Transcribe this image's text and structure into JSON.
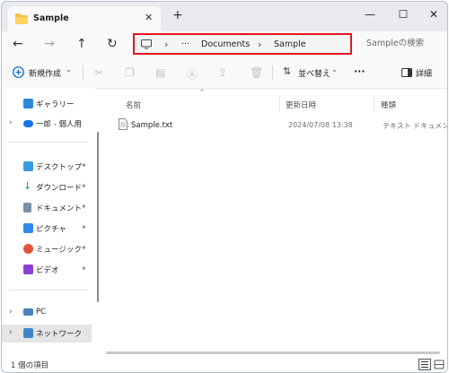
{
  "tab": {
    "title": "Sample",
    "close_label": "✕"
  },
  "titlebar": {
    "new_tab": "+",
    "minimize": "—",
    "maximize": "☐",
    "close": "✕"
  },
  "nav": {
    "back": "←",
    "forward": "→",
    "up": "↑",
    "refresh": "↻",
    "breadcrumb": {
      "chevron": "›",
      "more": "···",
      "items": [
        "Documents",
        "Sample"
      ]
    },
    "search_placeholder": "Sampleの検索"
  },
  "toolbar": {
    "new_label": "新規作成",
    "sort_label": "並べ替え",
    "more_label": "···",
    "details_label": "詳細",
    "caret": "⌄"
  },
  "sidebar": {
    "items": [
      {
        "label": "ギャラリー"
      },
      {
        "label": "一郎 - 個人用"
      },
      {
        "label": "デスクトップ"
      },
      {
        "label": "ダウンロード"
      },
      {
        "label": "ドキュメント"
      },
      {
        "label": "ピクチャ"
      },
      {
        "label": "ミュージック"
      },
      {
        "label": "ビデオ"
      },
      {
        "label": "PC"
      },
      {
        "label": "ネットワーク"
      }
    ],
    "pin_glyph": "📌",
    "expand_glyph": "›"
  },
  "columns": {
    "name": "名前",
    "date": "更新日時",
    "type": "種類"
  },
  "files": [
    {
      "name": "Sample.txt",
      "date": "2024/07/08 13:38",
      "type": "テキスト ドキュメント"
    }
  ],
  "status": {
    "item_count": "1 個の項目"
  },
  "colors": {
    "accent": "#0067c0",
    "highlight_border": "#e2171d",
    "selected_bg": "#e5e5e5"
  }
}
